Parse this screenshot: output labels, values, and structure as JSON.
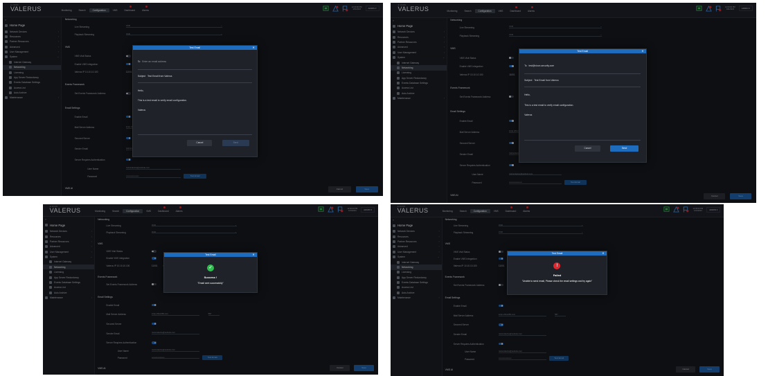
{
  "app": {
    "brand_sub": "⊕ VICON",
    "brand": "VALERUS",
    "nav_tabs": [
      "Monitoring",
      "Search",
      "Configuration",
      "VMS",
      "Dashboard",
      "Alarms"
    ],
    "clock_time": "12:00:00 PM",
    "clock_date": "1/01/2024",
    "admin_label": "ADMIN ▾"
  },
  "sidebar": {
    "home": "Home Page",
    "items": [
      "Network Devices",
      "Resources",
      "Partner Resources",
      "Advanced",
      "User Management",
      "System"
    ],
    "sub_items": [
      "Internet Gateway",
      "Networking",
      "Licensing",
      "App Server Redundancy",
      "Events Database Settings",
      "Access List",
      "Auto Archive"
    ],
    "maintenance": "Maintenance"
  },
  "settings": {
    "networking": "Networking",
    "live_streaming": "Live Streaming",
    "playback_streaming": "Playback Streaming",
    "stream_value": "VCR",
    "vms_section": "VMS",
    "vms_status": "VMS Visit Status",
    "enable_vms": "Enable VMS Integration",
    "vms_ip": "Valerus IP 10.10.10.100",
    "vms_port": "11001",
    "select_item": "Select Item",
    "events_section": "Events Framework",
    "events_address": "Set Events Framework Address",
    "email_section": "Email Settings",
    "enable_email": "Enable Email",
    "mail_server": "Mail Server Address",
    "mail_server_value": "smtp.office365.com",
    "mail_port": "587",
    "secured_server": "Secured Server",
    "sender_email": "Sender Email",
    "sender_value": "nvicondevice@outlook.com",
    "server_auth": "Server Requires Authentication",
    "user_name": "User Name",
    "user_value": "nvicondevice@outlook.com",
    "password": "Password",
    "password_value": "•••••••••••••••••••",
    "test_email": "Test Email",
    "vms_ai": "VMS AI",
    "enable_analytics": "Enable Analytics Services",
    "cancel": "Cancel",
    "save": "Save"
  },
  "dialog_compose": {
    "title": "Test Email",
    "to_label": "To",
    "to_placeholder": "Enter an email address",
    "to_value": "test@vicon-security.com",
    "subject_label": "Subject",
    "subject_value": "Test Email from Valerus",
    "body_greeting": "Hello,",
    "body_line": "This is a test email to verify email configuration.",
    "body_signature": "Valerus",
    "cancel": "Cancel",
    "send": "Send"
  },
  "dialog_success": {
    "title": "Test Email",
    "heading": "Success !",
    "message": "\"Email sent successfully\""
  },
  "dialog_failed": {
    "title": "Test Email",
    "heading": "Failed",
    "message": "\"Unable to send email, Please check the email settings and try again\""
  },
  "colors": {
    "accent": "#1d6cbe",
    "success": "#2fbf4f",
    "error": "#e0262f",
    "background": "#15171c"
  }
}
